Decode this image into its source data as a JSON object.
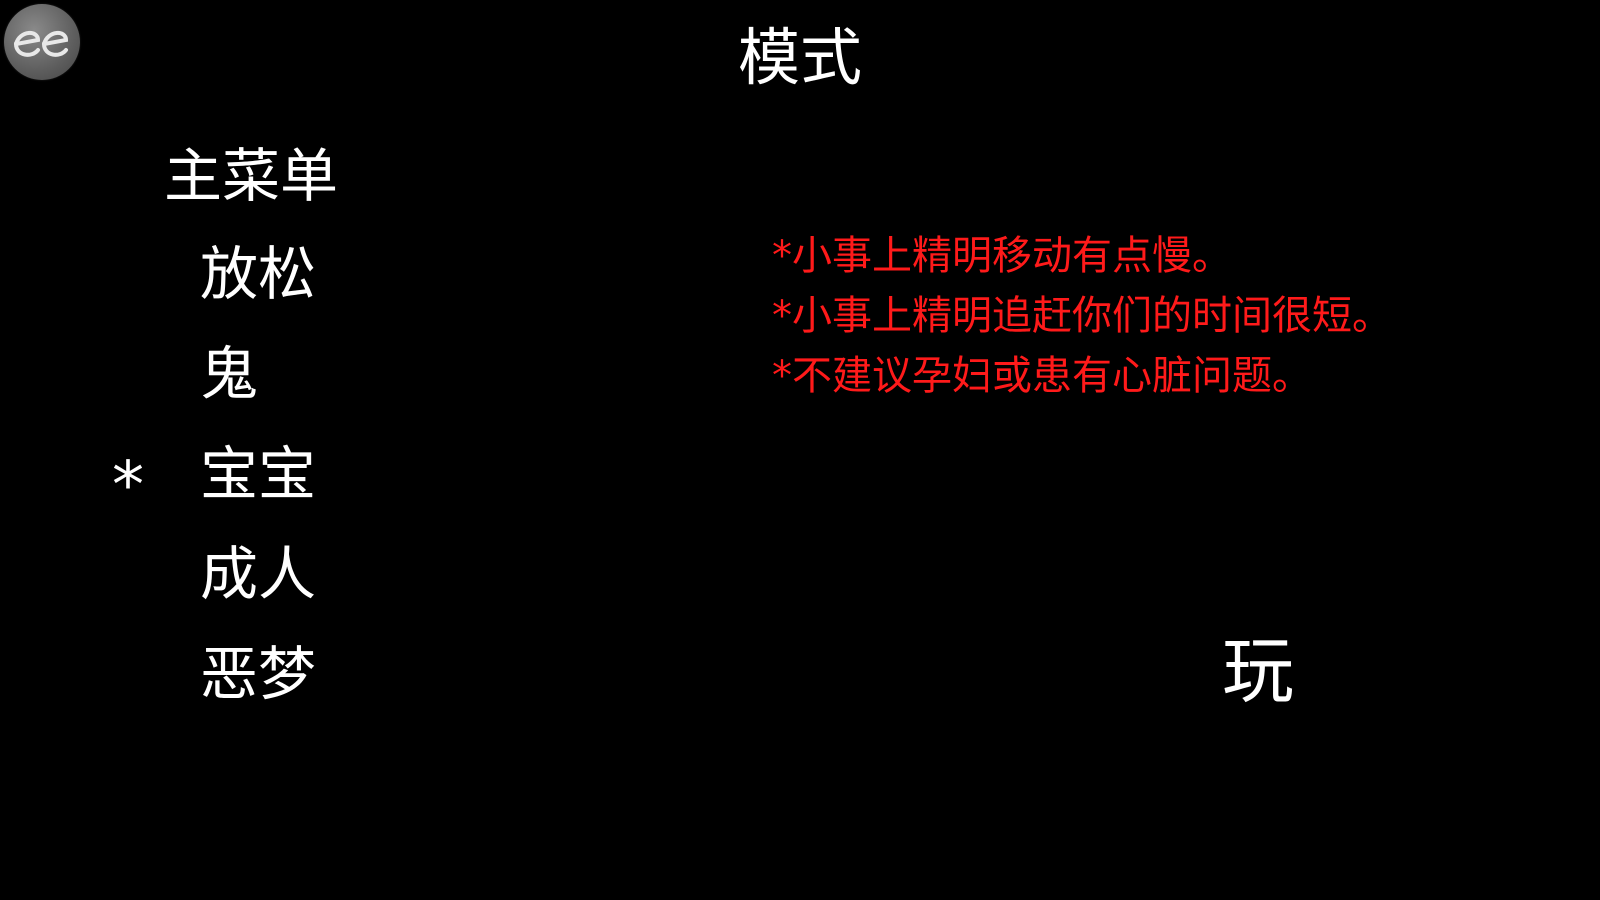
{
  "logo": {
    "icon": "ee-logo-icon",
    "color": "#6a6a6a"
  },
  "header": {
    "title": "模式"
  },
  "menu": {
    "main_menu_label": "主菜单",
    "selector_symbol": "*",
    "selected_index": 2,
    "items": [
      {
        "label": "放松"
      },
      {
        "label": "鬼"
      },
      {
        "label": "宝宝"
      },
      {
        "label": "成人"
      },
      {
        "label": "恶梦"
      }
    ]
  },
  "notes": {
    "color": "#ff1a1a",
    "lines": [
      "*小事上精明移动有点慢。",
      "*小事上精明追赶你们的时间很短。",
      "*不建议孕妇或患有心脏问题。"
    ]
  },
  "play": {
    "label": "玩"
  }
}
